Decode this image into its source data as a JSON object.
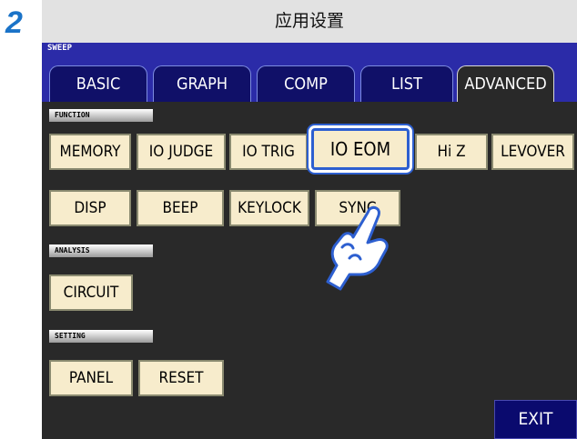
{
  "step_number": "2",
  "title": "应用设置",
  "sweep_label": "SWEEP",
  "tabs": [
    {
      "label": "BASIC"
    },
    {
      "label": "GRAPH"
    },
    {
      "label": "COMP"
    },
    {
      "label": "LIST"
    },
    {
      "label": "ADVANCED",
      "active": true
    }
  ],
  "sections": {
    "function": "FUNCTION",
    "analysis": "ANALYSIS",
    "setting": "SETTING"
  },
  "function_buttons_row1": [
    "MEMORY",
    "IO JUDGE",
    "IO TRIG",
    "IO EOM",
    "Hi Z",
    "LEVOVER"
  ],
  "function_buttons_row2": [
    "DISP",
    "BEEP",
    "KEYLOCK",
    "SYNC"
  ],
  "selected_button": "IO EOM",
  "analysis_buttons": [
    "CIRCUIT"
  ],
  "setting_buttons": [
    "PANEL",
    "RESET"
  ],
  "exit_label": "EXIT",
  "icons": {
    "hand": "pointing-hand-icon"
  },
  "colors": {
    "tab_bar": "#2b2ba8",
    "tab": "#101068",
    "button": "#f7eccc",
    "selected_border": "#2d5fd0",
    "step_number": "#1a73c8"
  }
}
